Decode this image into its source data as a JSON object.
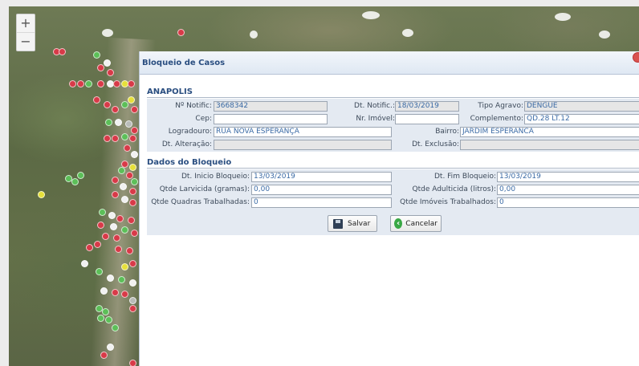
{
  "map": {
    "zoom_in_label": "+",
    "zoom_out_label": "−",
    "marker_colors": {
      "red": "#d83a48",
      "green": "#5cbf58",
      "white": "#f1f1f1",
      "yellow": "#e6e03a",
      "gray": "#b9bcb9"
    }
  },
  "dialog": {
    "title": "Bloqueio de Casos",
    "municipio": "ANAPOLIS",
    "fields": {
      "nr_notific_label": "Nº Notific:",
      "nr_notific_value": "3668342",
      "dt_notific_label": "Dt. Notific.:",
      "dt_notific_value": "18/03/2019",
      "tipo_agravo_label": "Tipo Agravo:",
      "tipo_agravo_value": "DENGUE",
      "cep_label": "Cep:",
      "cep_value": "",
      "nr_imovel_label": "Nr. Imóvel:",
      "nr_imovel_value": "",
      "complemento_label": "Complemento:",
      "complemento_value": "QD.28 LT.12",
      "logradouro_label": "Logradouro:",
      "logradouro_value": "RUA NOVA ESPERANÇA",
      "bairro_label": "Bairro:",
      "bairro_value": "JARDIM ESPERANCA",
      "dt_alteracao_label": "Dt. Alteração:",
      "dt_alteracao_value": "",
      "dt_exclusao_label": "Dt. Exclusão:",
      "dt_exclusao_value": ""
    },
    "bloqueio_section": "Dados do Bloqueio",
    "bloqueio": {
      "dt_inicio_label": "Dt. Inicio Bloqueio:",
      "dt_inicio_value": "13/03/2019",
      "dt_fim_label": "Dt. Fim Bloqueio:",
      "dt_fim_value": "13/03/2019",
      "larvicida_label": "Qtde Larvicida (gramas):",
      "larvicida_value": "0,00",
      "adulticida_label": "Qtde Adulticida (litros):",
      "adulticida_value": "0,00",
      "quadras_label": "Qtde Quadras Trabalhadas:",
      "quadras_value": "0",
      "imoveis_label": "Qtde Imóveis Trabalhados:",
      "imoveis_value": "0"
    },
    "buttons": {
      "save_label": "Salvar",
      "cancel_label": "Cancelar"
    }
  }
}
